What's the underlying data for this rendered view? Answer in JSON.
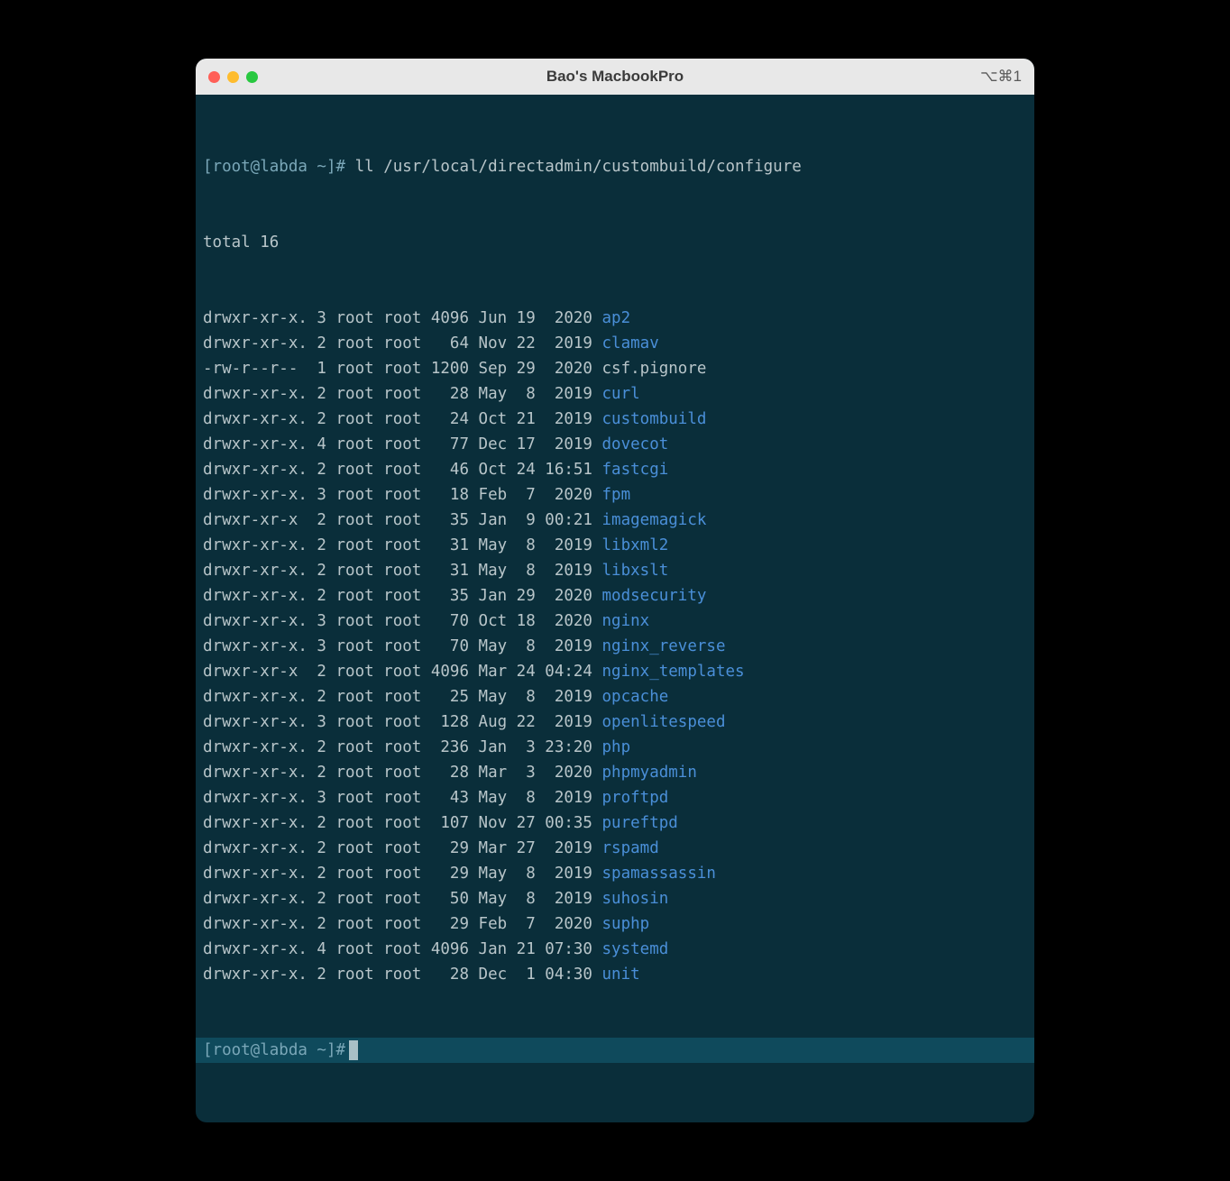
{
  "window": {
    "title": "Bao's MacbookPro",
    "shortcut": "⌥⌘1"
  },
  "prompt": "[root@labda ~]#",
  "command": "ll /usr/local/directadmin/custombuild/configure",
  "total": "total 16",
  "entries": [
    {
      "perm": "drwxr-xr-x.",
      "links": "3",
      "owner": "root",
      "group": "root",
      "size": "4096",
      "month": "Jun",
      "day": "19",
      "time": "2020",
      "name": "ap2",
      "isdir": true
    },
    {
      "perm": "drwxr-xr-x.",
      "links": "2",
      "owner": "root",
      "group": "root",
      "size": "64",
      "month": "Nov",
      "day": "22",
      "time": "2019",
      "name": "clamav",
      "isdir": true
    },
    {
      "perm": "-rw-r--r--",
      "links": "1",
      "owner": "root",
      "group": "root",
      "size": "1200",
      "month": "Sep",
      "day": "29",
      "time": "2020",
      "name": "csf.pignore",
      "isdir": false
    },
    {
      "perm": "drwxr-xr-x.",
      "links": "2",
      "owner": "root",
      "group": "root",
      "size": "28",
      "month": "May",
      "day": "8",
      "time": "2019",
      "name": "curl",
      "isdir": true
    },
    {
      "perm": "drwxr-xr-x.",
      "links": "2",
      "owner": "root",
      "group": "root",
      "size": "24",
      "month": "Oct",
      "day": "21",
      "time": "2019",
      "name": "custombuild",
      "isdir": true
    },
    {
      "perm": "drwxr-xr-x.",
      "links": "4",
      "owner": "root",
      "group": "root",
      "size": "77",
      "month": "Dec",
      "day": "17",
      "time": "2019",
      "name": "dovecot",
      "isdir": true
    },
    {
      "perm": "drwxr-xr-x.",
      "links": "2",
      "owner": "root",
      "group": "root",
      "size": "46",
      "month": "Oct",
      "day": "24",
      "time": "16:51",
      "name": "fastcgi",
      "isdir": true
    },
    {
      "perm": "drwxr-xr-x.",
      "links": "3",
      "owner": "root",
      "group": "root",
      "size": "18",
      "month": "Feb",
      "day": "7",
      "time": "2020",
      "name": "fpm",
      "isdir": true
    },
    {
      "perm": "drwxr-xr-x",
      "links": "2",
      "owner": "root",
      "group": "root",
      "size": "35",
      "month": "Jan",
      "day": "9",
      "time": "00:21",
      "name": "imagemagick",
      "isdir": true
    },
    {
      "perm": "drwxr-xr-x.",
      "links": "2",
      "owner": "root",
      "group": "root",
      "size": "31",
      "month": "May",
      "day": "8",
      "time": "2019",
      "name": "libxml2",
      "isdir": true
    },
    {
      "perm": "drwxr-xr-x.",
      "links": "2",
      "owner": "root",
      "group": "root",
      "size": "31",
      "month": "May",
      "day": "8",
      "time": "2019",
      "name": "libxslt",
      "isdir": true
    },
    {
      "perm": "drwxr-xr-x.",
      "links": "2",
      "owner": "root",
      "group": "root",
      "size": "35",
      "month": "Jan",
      "day": "29",
      "time": "2020",
      "name": "modsecurity",
      "isdir": true
    },
    {
      "perm": "drwxr-xr-x.",
      "links": "3",
      "owner": "root",
      "group": "root",
      "size": "70",
      "month": "Oct",
      "day": "18",
      "time": "2020",
      "name": "nginx",
      "isdir": true
    },
    {
      "perm": "drwxr-xr-x.",
      "links": "3",
      "owner": "root",
      "group": "root",
      "size": "70",
      "month": "May",
      "day": "8",
      "time": "2019",
      "name": "nginx_reverse",
      "isdir": true
    },
    {
      "perm": "drwxr-xr-x",
      "links": "2",
      "owner": "root",
      "group": "root",
      "size": "4096",
      "month": "Mar",
      "day": "24",
      "time": "04:24",
      "name": "nginx_templates",
      "isdir": true
    },
    {
      "perm": "drwxr-xr-x.",
      "links": "2",
      "owner": "root",
      "group": "root",
      "size": "25",
      "month": "May",
      "day": "8",
      "time": "2019",
      "name": "opcache",
      "isdir": true
    },
    {
      "perm": "drwxr-xr-x.",
      "links": "3",
      "owner": "root",
      "group": "root",
      "size": "128",
      "month": "Aug",
      "day": "22",
      "time": "2019",
      "name": "openlitespeed",
      "isdir": true
    },
    {
      "perm": "drwxr-xr-x.",
      "links": "2",
      "owner": "root",
      "group": "root",
      "size": "236",
      "month": "Jan",
      "day": "3",
      "time": "23:20",
      "name": "php",
      "isdir": true
    },
    {
      "perm": "drwxr-xr-x.",
      "links": "2",
      "owner": "root",
      "group": "root",
      "size": "28",
      "month": "Mar",
      "day": "3",
      "time": "2020",
      "name": "phpmyadmin",
      "isdir": true
    },
    {
      "perm": "drwxr-xr-x.",
      "links": "3",
      "owner": "root",
      "group": "root",
      "size": "43",
      "month": "May",
      "day": "8",
      "time": "2019",
      "name": "proftpd",
      "isdir": true
    },
    {
      "perm": "drwxr-xr-x.",
      "links": "2",
      "owner": "root",
      "group": "root",
      "size": "107",
      "month": "Nov",
      "day": "27",
      "time": "00:35",
      "name": "pureftpd",
      "isdir": true
    },
    {
      "perm": "drwxr-xr-x.",
      "links": "2",
      "owner": "root",
      "group": "root",
      "size": "29",
      "month": "Mar",
      "day": "27",
      "time": "2019",
      "name": "rspamd",
      "isdir": true
    },
    {
      "perm": "drwxr-xr-x.",
      "links": "2",
      "owner": "root",
      "group": "root",
      "size": "29",
      "month": "May",
      "day": "8",
      "time": "2019",
      "name": "spamassassin",
      "isdir": true
    },
    {
      "perm": "drwxr-xr-x.",
      "links": "2",
      "owner": "root",
      "group": "root",
      "size": "50",
      "month": "May",
      "day": "8",
      "time": "2019",
      "name": "suhosin",
      "isdir": true
    },
    {
      "perm": "drwxr-xr-x.",
      "links": "2",
      "owner": "root",
      "group": "root",
      "size": "29",
      "month": "Feb",
      "day": "7",
      "time": "2020",
      "name": "suphp",
      "isdir": true
    },
    {
      "perm": "drwxr-xr-x.",
      "links": "4",
      "owner": "root",
      "group": "root",
      "size": "4096",
      "month": "Jan",
      "day": "21",
      "time": "07:30",
      "name": "systemd",
      "isdir": true
    },
    {
      "perm": "drwxr-xr-x.",
      "links": "2",
      "owner": "root",
      "group": "root",
      "size": "28",
      "month": "Dec",
      "day": "1",
      "time": "04:30",
      "name": "unit",
      "isdir": true
    }
  ]
}
